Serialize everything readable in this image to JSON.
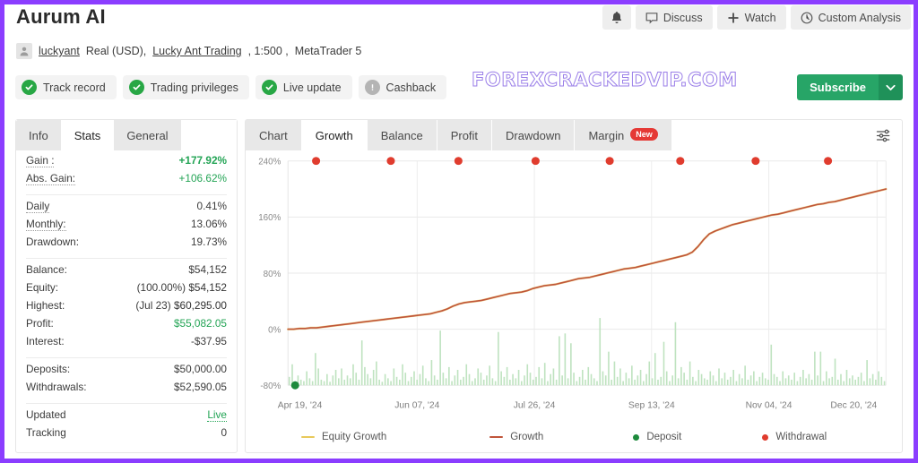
{
  "header": {
    "title": "Aurum AI",
    "actions": [
      {
        "name": "notifications",
        "icon": "bell-icon",
        "label": ""
      },
      {
        "name": "discuss",
        "icon": "comment-icon",
        "label": "Discuss"
      },
      {
        "name": "watch",
        "icon": "plus-icon",
        "label": "Watch"
      },
      {
        "name": "custom-analysis",
        "icon": "clock-icon",
        "label": "Custom Analysis"
      }
    ]
  },
  "account": {
    "username": "luckyant",
    "type": "Real (USD),",
    "broker": "Lucky Ant Trading",
    "leverage": ", 1:500 ,",
    "platform": "MetaTrader 5"
  },
  "badges": [
    {
      "label": "Track record",
      "state": "ok"
    },
    {
      "label": "Trading privileges",
      "state": "ok"
    },
    {
      "label": "Live update",
      "state": "ok"
    },
    {
      "label": "Cashback",
      "state": "off"
    }
  ],
  "watermark": "FOREXCRACKEDVIP.COM",
  "subscribe": {
    "label": "Subscribe",
    "caret": "❯"
  },
  "left_panel": {
    "tabs": [
      {
        "label": "Info",
        "active": false
      },
      {
        "label": "Stats",
        "active": true
      },
      {
        "label": "General",
        "active": false
      }
    ],
    "groups": [
      {
        "rows": [
          {
            "key": "Gain :",
            "value": "+177.92%",
            "style": "green",
            "dotted": true
          },
          {
            "key": "Abs. Gain:",
            "value": "+106.62%",
            "style": "greenplain",
            "dotted": true
          }
        ]
      },
      {
        "rows": [
          {
            "key": "Daily",
            "value": "0.41%",
            "style": "",
            "dotted": true
          },
          {
            "key": "Monthly:",
            "value": "13.06%",
            "style": "",
            "dotted": true
          },
          {
            "key": "Drawdown:",
            "value": "19.73%",
            "style": "",
            "dotted": false
          }
        ]
      },
      {
        "rows": [
          {
            "key": "Balance:",
            "value": "$54,152",
            "style": "",
            "dotted": false
          },
          {
            "key": "Equity:",
            "prefix": "(100.00%)",
            "value": "$54,152",
            "style": "",
            "dotted": false
          },
          {
            "key": "Highest:",
            "prefix": "(Jul 23)",
            "value": "$60,295.00",
            "style": "",
            "dotted": false
          },
          {
            "key": "Profit:",
            "value": "$55,082.05",
            "style": "greenplain",
            "dotted": false
          },
          {
            "key": "Interest:",
            "value": "-$37.95",
            "style": "",
            "dotted": false
          }
        ]
      },
      {
        "rows": [
          {
            "key": "Deposits:",
            "value": "$50,000.00",
            "style": "",
            "dotted": false
          },
          {
            "key": "Withdrawals:",
            "value": "$52,590.05",
            "style": "",
            "dotted": false
          }
        ]
      },
      {
        "rows": [
          {
            "key": "Updated",
            "value": "Live",
            "style": "live",
            "dotted": false
          },
          {
            "key": "Tracking",
            "value": "0",
            "style": "",
            "dotted": false
          }
        ]
      }
    ]
  },
  "chart_panel": {
    "tabs": [
      {
        "label": "Chart",
        "active": false,
        "badge": ""
      },
      {
        "label": "Growth",
        "active": true,
        "badge": ""
      },
      {
        "label": "Balance",
        "active": false,
        "badge": ""
      },
      {
        "label": "Profit",
        "active": false,
        "badge": ""
      },
      {
        "label": "Drawdown",
        "active": false,
        "badge": ""
      },
      {
        "label": "Margin",
        "active": false,
        "badge": "New"
      }
    ],
    "settings_icon": "sliders-icon"
  },
  "chart_data": {
    "type": "line",
    "title": "Growth",
    "xlabel": "",
    "ylabel": "",
    "ylim": [
      -80,
      240
    ],
    "yticks": [
      240,
      160,
      80,
      0,
      -80
    ],
    "ytick_labels": [
      "240%",
      "160%",
      "80%",
      "0%",
      "-80%"
    ],
    "xtick_labels": [
      "Apr 19, '24",
      "Jun 07, '24",
      "Jul 26, '24",
      "Sep 13, '24",
      "Nov 04, '24",
      "Dec 20, '24"
    ],
    "xtick_positions": [
      0.02,
      0.216,
      0.412,
      0.608,
      0.804,
      0.985
    ],
    "grid": true,
    "legend": [
      {
        "label": "Equity Growth",
        "marker": "line",
        "color": "#e8c95a"
      },
      {
        "label": "Growth",
        "marker": "line",
        "color": "#c0553a"
      },
      {
        "label": "Deposit",
        "marker": "dot",
        "color": "#1d8a3c"
      },
      {
        "label": "Withdrawal",
        "marker": "dot",
        "color": "#e03c2e"
      }
    ],
    "series": [
      {
        "name": "Growth",
        "color": "#c0553a",
        "values": [
          0,
          0,
          1,
          1,
          2,
          2,
          3,
          4,
          5,
          6,
          7,
          8,
          9,
          10,
          11,
          12,
          13,
          14,
          15,
          16,
          17,
          18,
          19,
          20,
          21,
          22,
          24,
          26,
          29,
          33,
          36,
          38,
          39,
          40,
          41,
          43,
          45,
          47,
          49,
          51,
          52,
          53,
          55,
          58,
          60,
          62,
          63,
          64,
          66,
          68,
          70,
          72,
          73,
          74,
          76,
          78,
          80,
          82,
          84,
          86,
          87,
          88,
          90,
          92,
          94,
          96,
          98,
          100,
          102,
          104,
          106,
          110,
          118,
          128,
          136,
          140,
          143,
          146,
          149,
          151,
          153,
          155,
          157,
          159,
          161,
          163,
          164,
          166,
          168,
          170,
          172,
          174,
          176,
          178,
          179,
          181,
          182,
          184,
          186,
          188,
          190,
          192,
          194,
          196,
          198,
          200
        ]
      },
      {
        "name": "Equity Growth",
        "color": "#e8c95a",
        "values": [
          0,
          0,
          1,
          1,
          2,
          2,
          3,
          4,
          5,
          6,
          7,
          8,
          9,
          10,
          11,
          12,
          13,
          14,
          15,
          16,
          17,
          18,
          19,
          20,
          21,
          22,
          24,
          26,
          29,
          33,
          36,
          38,
          39,
          40,
          41,
          43,
          45,
          47,
          49,
          51,
          52,
          53,
          55,
          58,
          60,
          62,
          63,
          64,
          66,
          68,
          70,
          72,
          73,
          74,
          76,
          78,
          80,
          82,
          84,
          86,
          87,
          88,
          90,
          92,
          94,
          96,
          98,
          100,
          102,
          104,
          106,
          110,
          118,
          128,
          136,
          140,
          143,
          146,
          149,
          151,
          153,
          155,
          157,
          159,
          161,
          163,
          164,
          166,
          168,
          170,
          172,
          174,
          176,
          178,
          179,
          181,
          182,
          184,
          186,
          188,
          190,
          192,
          194,
          196,
          198,
          200
        ]
      }
    ],
    "bars": {
      "name": "Daily activity",
      "color": "#bfe3c0",
      "baseline": -80,
      "values": [
        12,
        30,
        6,
        14,
        8,
        6,
        20,
        10,
        6,
        46,
        24,
        8,
        6,
        16,
        5,
        14,
        22,
        10,
        24,
        8,
        14,
        10,
        30,
        18,
        8,
        64,
        26,
        16,
        10,
        22,
        34,
        8,
        5,
        16,
        10,
        6,
        24,
        12,
        8,
        30,
        18,
        6,
        12,
        20,
        8,
        16,
        28,
        10,
        6,
        36,
        14,
        8,
        78,
        18,
        10,
        26,
        6,
        14,
        22,
        8,
        12,
        30,
        16,
        6,
        10,
        24,
        18,
        8,
        14,
        28,
        10,
        6,
        76,
        20,
        12,
        26,
        8,
        16,
        10,
        22,
        6,
        14,
        30,
        18,
        8,
        12,
        26,
        10,
        32,
        6,
        16,
        24,
        8,
        70,
        14,
        74,
        10,
        60,
        18,
        6,
        12,
        22,
        8,
        26,
        16,
        10,
        6,
        96,
        20,
        14,
        48,
        8,
        34,
        12,
        24,
        6,
        18,
        10,
        28,
        8,
        14,
        22,
        6,
        16,
        34,
        10,
        46,
        8,
        12,
        62,
        20,
        6,
        14,
        90,
        10,
        26,
        18,
        8,
        34,
        12,
        6,
        22,
        16,
        10,
        8,
        20,
        14,
        6,
        24,
        10,
        18,
        8,
        12,
        22,
        6,
        16,
        10,
        28,
        8,
        14,
        20,
        6,
        12,
        18,
        10,
        8,
        58,
        16,
        12,
        6,
        20,
        10,
        14,
        8,
        18,
        6,
        12,
        22,
        10,
        16,
        8,
        48,
        14,
        48,
        6,
        20,
        10,
        12,
        38,
        8,
        16,
        6,
        22,
        10,
        14,
        8,
        12,
        18,
        6,
        36,
        10,
        16,
        8,
        20,
        12,
        6
      ]
    },
    "markers": {
      "withdrawals": {
        "label": "Withdrawal",
        "color": "#e03c2e",
        "y": 240,
        "x": [
          0.047,
          0.172,
          0.285,
          0.414,
          0.538,
          0.656,
          0.782,
          0.903
        ]
      },
      "deposits": {
        "label": "Deposit",
        "color": "#1d8a3c",
        "y": -80,
        "x": [
          0.012
        ]
      }
    }
  }
}
